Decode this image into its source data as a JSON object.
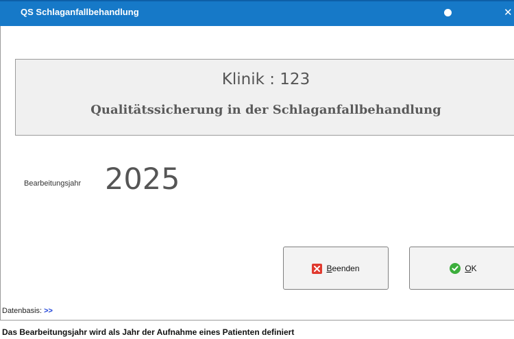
{
  "window": {
    "title": "QS Schlaganfallbehandlung",
    "accent_color": "#1679c8"
  },
  "header": {
    "clinic": "Klinik : 123",
    "subtitle": "Qualitätssicherung in der Schlaganfallbehandlung"
  },
  "year": {
    "label": "Bearbeitungsjahr",
    "value": "2025"
  },
  "buttons": {
    "beenden": {
      "label_first": "B",
      "label_rest": "eenden",
      "icon": "close-icon",
      "icon_color": "#e03a2f"
    },
    "ok": {
      "label_first": "O",
      "label_rest": "K",
      "icon": "check-icon",
      "icon_color": "#3cae3c"
    }
  },
  "datenbasis": {
    "label": "Datenbasis:",
    "link": ">>"
  },
  "status": {
    "text": "Das Bearbeitungsjahr wird als Jahr der Aufnahme eines Patienten definiert"
  }
}
